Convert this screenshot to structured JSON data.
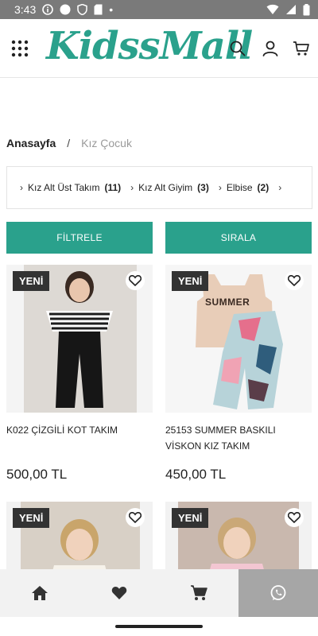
{
  "status_bar": {
    "time": "3:43",
    "dot": "•"
  },
  "header": {
    "logo": "KidssMall",
    "icons": [
      "grid-menu-icon",
      "search-icon",
      "user-icon",
      "cart-icon"
    ]
  },
  "breadcrumb": {
    "home": "Anasayfa",
    "separator": "/",
    "current": "Kız Çocuk"
  },
  "categories": [
    {
      "label": "Kız Alt Üst Takım",
      "count": "(11)"
    },
    {
      "label": "Kız Alt Giyim",
      "count": "(3)"
    },
    {
      "label": "Elbise",
      "count": "(2)"
    }
  ],
  "buttons": {
    "filter": "FİLTRELE",
    "sort": "SIRALA"
  },
  "products": [
    {
      "badge": "YENİ",
      "name": "K022 ÇİZGİLİ KOT TAKIM",
      "price": "500,00 TL"
    },
    {
      "badge": "YENİ",
      "name": "25153 SUMMER BASKILI VİSKON KIZ TAKIM",
      "price": "450,00 TL",
      "print_text": "SUMMER"
    },
    {
      "badge": "YENİ"
    },
    {
      "badge": "YENİ"
    }
  ],
  "colors": {
    "accent": "#2aa18c",
    "badge": "#333333",
    "status_bar": "#7a7a7a",
    "nav_bg": "#f2f2f2",
    "whatsapp_bg": "#a6a6a6"
  },
  "bottom_nav": [
    "home-icon",
    "heart-icon",
    "cart-icon",
    "whatsapp-icon"
  ]
}
